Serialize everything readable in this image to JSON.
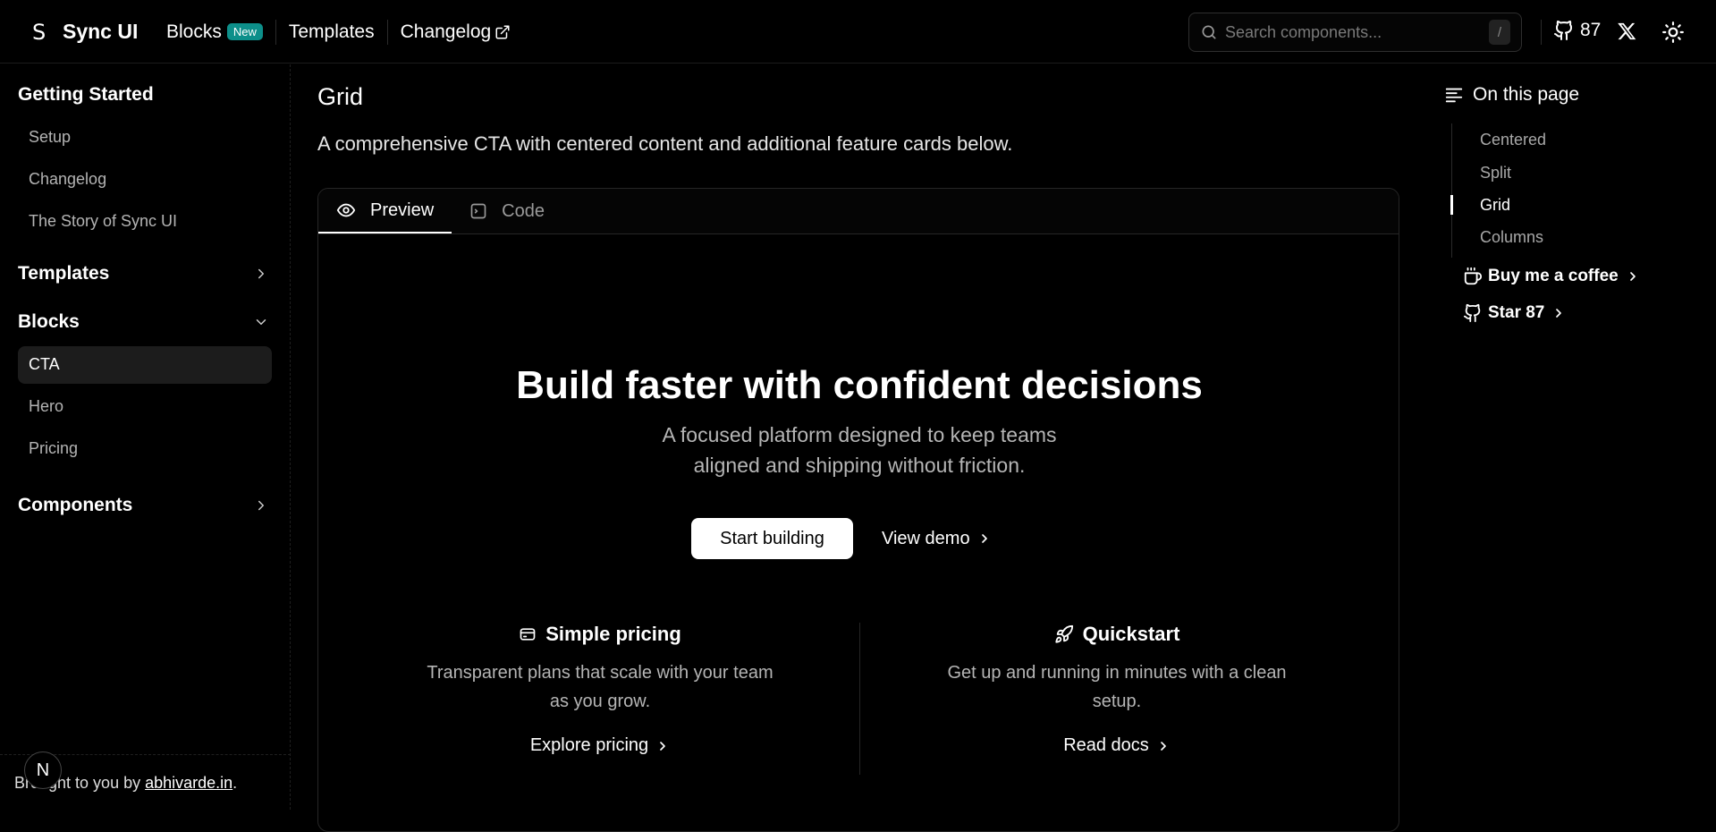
{
  "header": {
    "logo_mark": "S",
    "brand": "Sync UI",
    "nav": {
      "blocks": "Blocks",
      "new_badge": "New",
      "templates": "Templates",
      "changelog": "Changelog"
    },
    "search_placeholder": "Search components...",
    "search_shortcut": "/",
    "github_stars": "87"
  },
  "sidebar": {
    "getting_started": {
      "title": "Getting Started",
      "items": [
        "Setup",
        "Changelog",
        "The Story of Sync UI"
      ]
    },
    "templates": "Templates",
    "blocks": {
      "title": "Blocks",
      "items": [
        "CTA",
        "Hero",
        "Pricing"
      ],
      "active": "CTA"
    },
    "components": "Components",
    "footer": {
      "prefix": "Brought to you by ",
      "link": "abhivarde.in",
      "suffix": "."
    },
    "n_badge": "N"
  },
  "main": {
    "title": "Grid",
    "description": "A comprehensive CTA with centered content and additional feature cards below.",
    "tabs": [
      "Preview",
      "Code"
    ],
    "active_tab": "Preview",
    "preview": {
      "headline": "Build faster with confident decisions",
      "subheadline": "A focused platform designed to keep teams aligned and shipping without friction.",
      "primary_cta": "Start building",
      "secondary_cta": "View demo",
      "features": [
        {
          "icon": "card-icon",
          "title": "Simple pricing",
          "description": "Transparent plans that scale with your team as you grow.",
          "link": "Explore pricing"
        },
        {
          "icon": "rocket-icon",
          "title": "Quickstart",
          "description": "Get up and running in minutes with a clean setup.",
          "link": "Read docs"
        }
      ]
    }
  },
  "toc": {
    "heading": "On this page",
    "items": [
      "Centered",
      "Split",
      "Grid",
      "Columns"
    ],
    "active": "Grid",
    "coffee": "Buy me a coffee",
    "star": "Star 87"
  },
  "colors": {
    "background": "#000000",
    "badge": "#0d8f8a",
    "active_bg": "#1c1c1c",
    "muted_text": "#b5b5b5"
  }
}
